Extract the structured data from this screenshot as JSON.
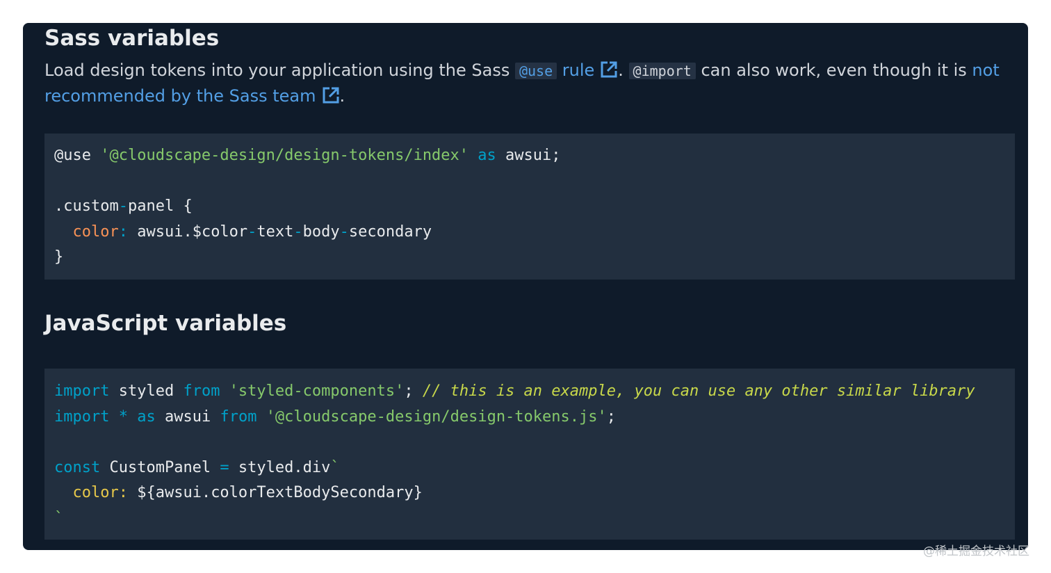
{
  "sass_section": {
    "heading": "Sass variables",
    "para_part1": "Load design tokens into your application using the Sass ",
    "inline_use": "@use",
    "link_rule": " rule",
    "sep1": ". ",
    "inline_import": "@import",
    "para_part2": " can also work, even though it is ",
    "link_not_recommended": "not recommended by the Sass team",
    "period": ".",
    "code": {
      "l1_kw": "@use",
      "l1_sp1": " ",
      "l1_str": "'@cloudscape-design/design-tokens/index'",
      "l1_sp2": " ",
      "l1_as": "as",
      "l1_rest": " awsui;",
      "l3_a": ".custom",
      "l3_dash": "-",
      "l3_b": "panel {",
      "l4_indent": "  ",
      "l4_prop": "color",
      "l4_colon": ":",
      "l4_a": " awsui.$color",
      "l4_d1": "-",
      "l4_b": "text",
      "l4_d2": "-",
      "l4_c": "body",
      "l4_d3": "-",
      "l4_e": "secondary",
      "l5": "}"
    }
  },
  "js_section": {
    "heading": "JavaScript variables",
    "code": {
      "l1_import": "import",
      "l1_a": " styled ",
      "l1_from": "from",
      "l1_sp": " ",
      "l1_str": "'styled-components'",
      "l1_semi": "; ",
      "l1_cmt": "// this is an example, you can use any other similar library",
      "l2_import": "import",
      "l2_sp1": " ",
      "l2_star": "*",
      "l2_sp2": " ",
      "l2_as": "as",
      "l2_a": " awsui ",
      "l2_from": "from",
      "l2_sp3": " ",
      "l2_str": "'@cloudscape-design/design-tokens.js'",
      "l2_semi": ";",
      "l4_const": "const",
      "l4_a": " CustomPanel ",
      "l4_eq": "=",
      "l4_b": " styled.div",
      "l4_tick": "`",
      "l5_indent": "  ",
      "l5_prop": "color",
      "l5_colon": ":",
      "l5_rest": " ${awsui.colorTextBodySecondary}",
      "l6_tick": "`"
    }
  },
  "watermark": "@稀土掘金技术社区"
}
